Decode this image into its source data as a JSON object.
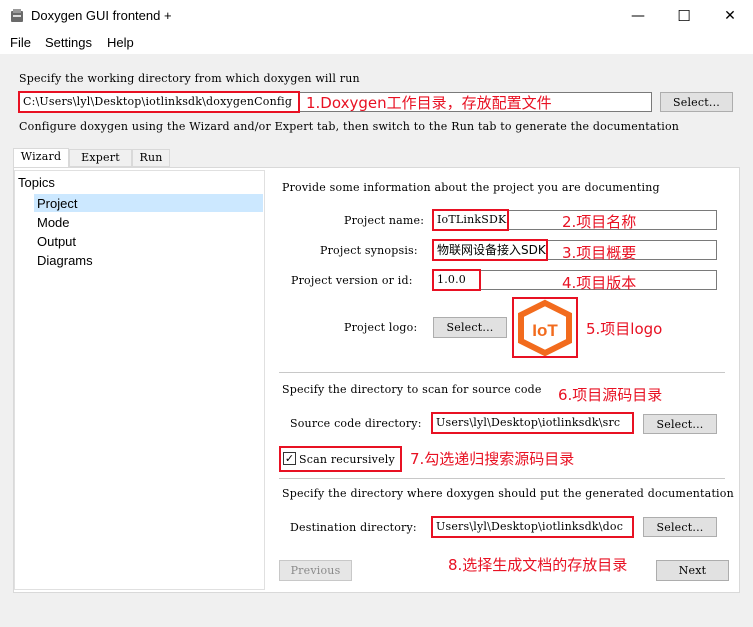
{
  "window": {
    "title": "Doxygen GUI frontend +",
    "minimize": "—",
    "maximize": "☐",
    "close": "✕"
  },
  "menu": {
    "file": "File",
    "settings": "Settings",
    "help": "Help"
  },
  "workdir": {
    "label": "Specify the working directory from which doxygen will run",
    "value": "C:\\Users\\lyl\\Desktop\\iotlinksdk\\doxygenConfig",
    "select": "Select...",
    "annotation": "1.Doxygen工作目录，存放配置文件",
    "hint": "Configure doxygen using the Wizard and/or Expert tab, then switch to the Run tab to generate the documentation"
  },
  "tabs": [
    "Wizard",
    "Expert",
    "Run"
  ],
  "topics": {
    "title": "Topics",
    "items": [
      "Project",
      "Mode",
      "Output",
      "Diagrams"
    ]
  },
  "project": {
    "intro": "Provide some information about the project you are documenting",
    "name_label": "Project name:",
    "name_value": "IoTLinkSDK",
    "name_note": "2.项目名称",
    "synopsis_label": "Project synopsis:",
    "synopsis_value": "物联网设备接入SDK",
    "synopsis_note": "3.项目概要",
    "version_label": "Project version or id:",
    "version_value": "1.0.0",
    "version_note": "4.项目版本",
    "logo_label": "Project logo:",
    "logo_select": "Select...",
    "logo_note": "5.项目logo",
    "logo_text": "IoT",
    "src_intro": "Specify the directory to scan for source code",
    "src_note": "6.项目源码目录",
    "src_label": "Source code directory:",
    "src_value": "Users\\lyl\\Desktop\\iotlinksdk\\src",
    "src_select": "Select...",
    "scan_label": "Scan recursively",
    "scan_note": "7.勾选递归搜索源码目录",
    "dest_intro": "Specify the directory where doxygen should put the generated documentation",
    "dest_label": "Destination directory:",
    "dest_value": "Users\\lyl\\Desktop\\iotlinksdk\\doc",
    "dest_select": "Select...",
    "dest_note": "8.选择生成文档的存放目录"
  },
  "nav": {
    "previous": "Previous",
    "next": "Next"
  },
  "colors": {
    "annotation": "#e81123",
    "logo": "#f26b1d",
    "selection": "#cce8ff"
  }
}
